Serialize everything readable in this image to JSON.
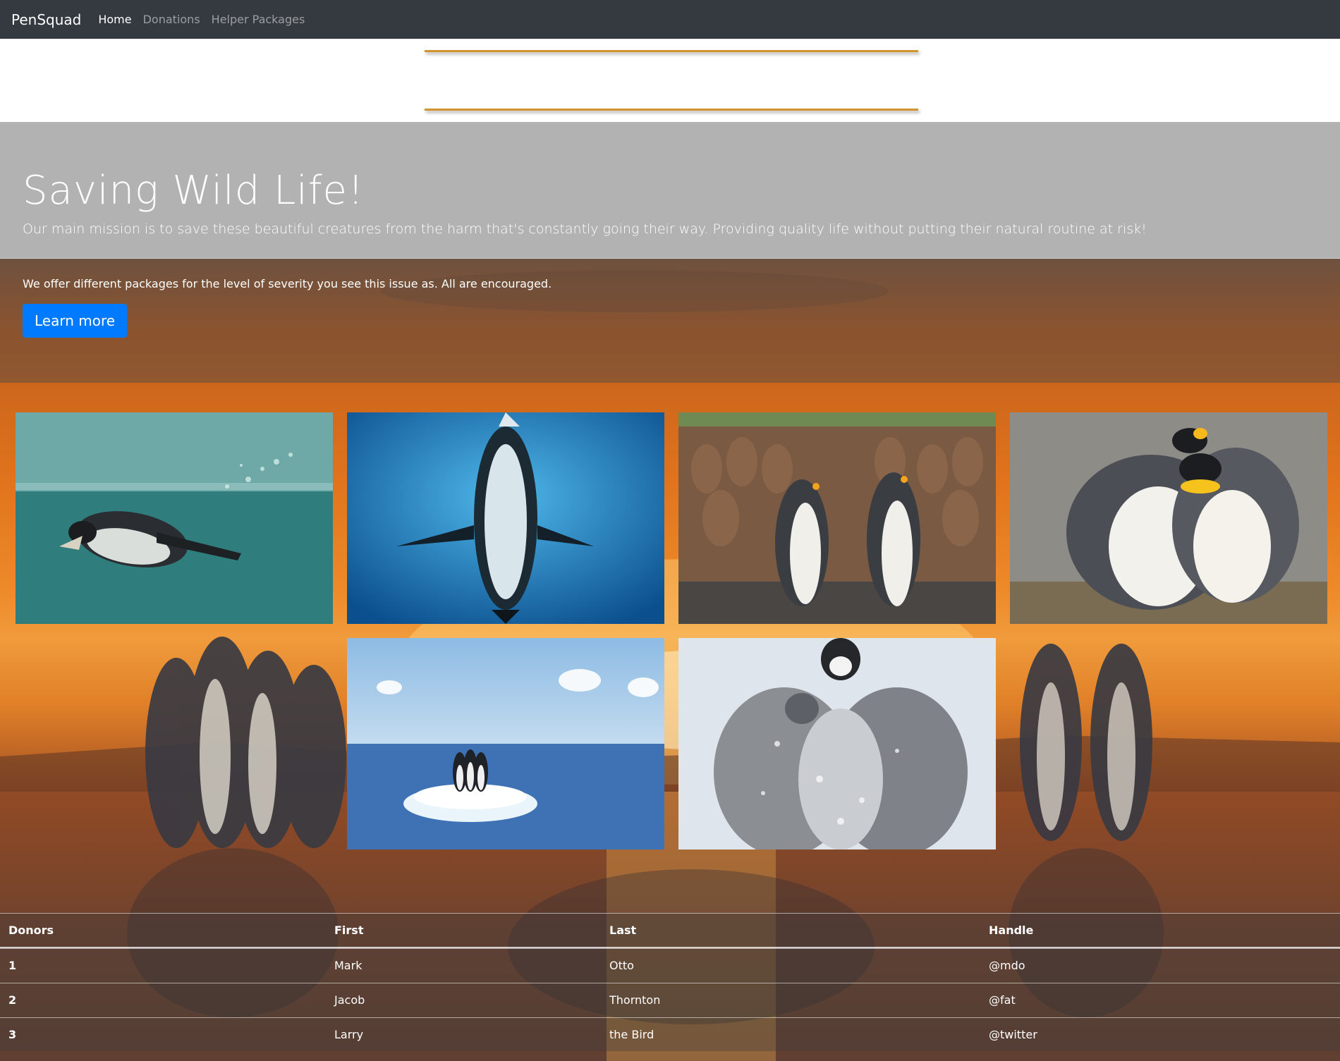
{
  "navbar": {
    "brand": "PenSquad",
    "links": [
      "Home",
      "Donations",
      "Helper Packages"
    ]
  },
  "hero": {
    "title": "Saving Wild Life!",
    "lead": "Our main mission is to save these beautiful creatures from the harm that's constantly going their way. Providing quality life without putting their natural routine at risk!",
    "subtext": "We offer different packages for the level of severity you see this issue as. All are encouraged.",
    "button": "Learn more"
  },
  "gallery": {
    "photos": [
      "penguin-swimming-underwater",
      "penguin-diving-blue-water",
      "king-penguin-colony",
      "king-penguin-couple",
      "penguins-on-ice-floe",
      "emperor-penguin-chick-huddle"
    ]
  },
  "table": {
    "headers": [
      "Donors",
      "First",
      "Last",
      "Handle"
    ],
    "rows": [
      [
        "1",
        "Mark",
        "Otto",
        "@mdo"
      ],
      [
        "2",
        "Jacob",
        "Thornton",
        "@fat"
      ],
      [
        "3",
        "Larry",
        "the Bird",
        "@twitter"
      ]
    ]
  },
  "colors": {
    "navbar": "#343a40",
    "accent_line": "#d2942c",
    "jumbotron": "#b2b2b2",
    "button": "#007bff"
  }
}
